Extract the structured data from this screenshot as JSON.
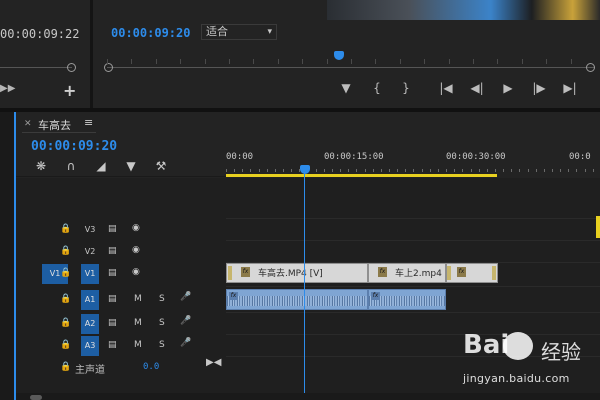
{
  "source_monitor": {
    "timecode": "00:00:09:22",
    "add_icon": "plus-icon"
  },
  "program_monitor": {
    "timecode": "00:00:09:20",
    "fit_value": "适合",
    "controls": [
      "marker-icon",
      "mark-in-icon",
      "mark-out-icon",
      "go-to-in-icon",
      "step-back-icon",
      "play-icon",
      "step-forward-icon",
      "go-to-out-icon"
    ]
  },
  "timeline": {
    "tab_title": "车高去",
    "timecode": "00:00:09:20",
    "ruler": [
      "00:00",
      "00:00:15:00",
      "00:00:30:00",
      "00:0"
    ],
    "tracks": {
      "v3": "V3",
      "v2": "V2",
      "v1": "V1",
      "src_v1": "V1",
      "a1": "A1",
      "a2": "A2",
      "a3": "A3",
      "mute": "M",
      "solo": "S"
    },
    "clips": {
      "v1_a": "车高去.MP4 [V]",
      "v1_b": "车上2.mp4",
      "fx": "fx"
    },
    "master": {
      "label": "主声道",
      "value": "0.0"
    }
  },
  "watermark": {
    "logo": "Bai",
    "text": "经验",
    "url": "jingyan.baidu.com"
  },
  "colors": {
    "accent_blue": "#2d8ceb",
    "work_area": "#e8d020",
    "video_clip": "#d7d7d7",
    "audio_clip": "#7fa5d3"
  }
}
